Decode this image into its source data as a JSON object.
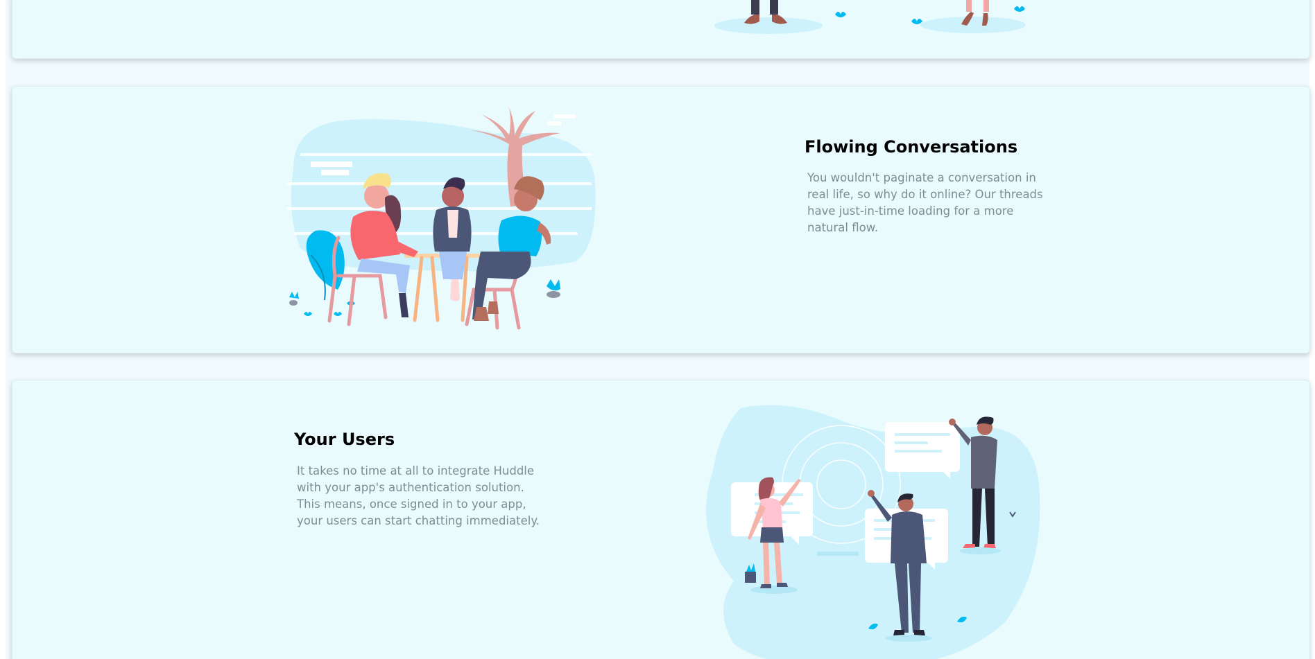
{
  "features": [
    {
      "title": "Flowing Conversations",
      "description": "You wouldn't paginate a conversation in real life, so why do it online? Our threads have just-in-time loading for a more natural flow."
    },
    {
      "title": "Your Users",
      "description": "It takes no time at all to integrate Huddle with your app's authentication solution. This means, once signed in to your app, your users can start chatting immediately."
    }
  ],
  "colors": {
    "page_background": "#f1fbfd",
    "card_background": "#eafbfe",
    "title": "#000000",
    "body_text": "#7f8c92",
    "accent_cyan": "#00baf0",
    "pink": "#f8676e"
  },
  "illustrations": {
    "top": "people-standing-illustration",
    "conversations": "people-at-table-illustration",
    "users": "people-with-chat-bubbles-illustration"
  }
}
